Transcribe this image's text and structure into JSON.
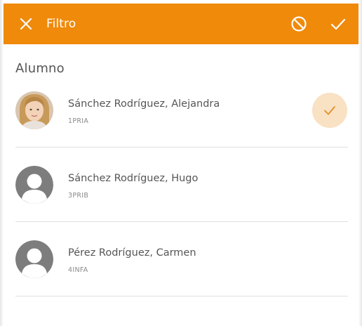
{
  "header": {
    "title": "Filtro",
    "close_icon": "close-icon",
    "clear_icon": "block-icon",
    "confirm_icon": "check-icon",
    "background_color": "#f08a0b",
    "text_color": "#ffffff"
  },
  "section": {
    "title": "Alumno"
  },
  "students": [
    {
      "name": "Sánchez Rodríguez, Alejandra",
      "group": "1PRIA",
      "selected": true,
      "avatar": "photo"
    },
    {
      "name": "Sánchez Rodríguez, Hugo",
      "group": "3PRIB",
      "selected": false,
      "avatar": "placeholder-person-icon"
    },
    {
      "name": "Pérez Rodríguez, Carmen",
      "group": "4INFA",
      "selected": false,
      "avatar": "placeholder-person-icon"
    }
  ],
  "colors": {
    "accent": "#f08a0b",
    "selected_badge_bg": "#f9e1c3",
    "selected_check": "#e0902a",
    "divider": "#e0e0e0"
  }
}
